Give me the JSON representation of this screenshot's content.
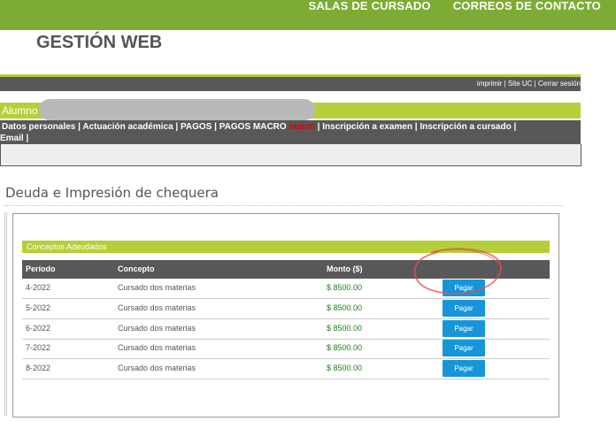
{
  "top_nav": {
    "salas": "SALAS DE CURSADO",
    "correos": "CORREOS DE CONTACTO"
  },
  "site_title": "GESTIÓN WEB",
  "util_links": {
    "imprimir": "imprimir",
    "site_uc": "Site UC",
    "cerrar": "Cerrar sesión",
    "sep": " | "
  },
  "student": {
    "label": "Alumno"
  },
  "menu": {
    "datos": "Datos personales",
    "actuacion": "Actuación académica",
    "pagos": "PAGOS",
    "pagos_macro": "PAGOS MACRO",
    "nuevo": "nuevo",
    "inscripcion_examen": "Inscripción a examen",
    "inscripcion_cursado": "Inscripción a cursado",
    "email": "Email",
    "sep": " | "
  },
  "page_title": "Deuda e Impresión de chequera",
  "table": {
    "section_title": "Conceptos Adeudados",
    "headers": {
      "periodo": "Período",
      "concepto": "Concepto",
      "monto": "Monto ($)"
    },
    "rows": [
      {
        "periodo": "4-2022",
        "concepto": "Cursado dos materias",
        "monto": "$ 8500.00",
        "button": "Pagar"
      },
      {
        "periodo": "5-2022",
        "concepto": "Cursado dos materias",
        "monto": "$ 8500.00",
        "button": "Pagar"
      },
      {
        "periodo": "6-2022",
        "concepto": "Cursado dos materias",
        "monto": "$ 8500.00",
        "button": "Pagar"
      },
      {
        "periodo": "7-2022",
        "concepto": "Cursado dos materias",
        "monto": "$ 8500.00",
        "button": "Pagar"
      },
      {
        "periodo": "8-2022",
        "concepto": "Cursado dos materias",
        "monto": "$ 8500.00",
        "button": "Pagar"
      }
    ]
  },
  "colors": {
    "green": "#7cac33",
    "lime": "#b5cf3b",
    "dark_gray": "#585858",
    "button_blue": "#1696d8",
    "money_green": "#1a7f1a",
    "annotation_red": "#e05050"
  }
}
